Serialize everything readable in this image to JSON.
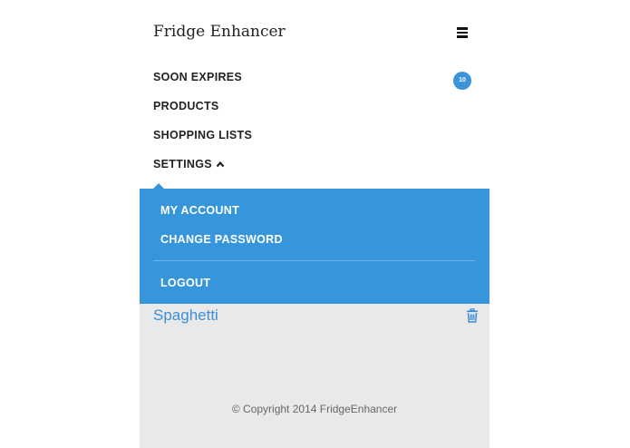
{
  "header": {
    "brand": "Fridge Enhancer",
    "menu_icon": "hamburger-menu-icon"
  },
  "nav": {
    "items": [
      {
        "label": "SOON EXPIRES",
        "badge": "10"
      },
      {
        "label": "PRODUCTS"
      },
      {
        "label": "SHOPPING LISTS"
      },
      {
        "label": "SETTINGS",
        "icon": "chevron-up-icon"
      }
    ]
  },
  "settings_menu": {
    "items": [
      {
        "label": "MY ACCOUNT"
      },
      {
        "label": "CHANGE PASSWORD"
      },
      {
        "label": "LOGOUT"
      }
    ]
  },
  "content": {
    "items": [
      {
        "name": "Spaghetti",
        "icon": "trash-icon"
      }
    ]
  },
  "footer": {
    "copyright": "© Copyright 2014 FridgeEnhancer"
  },
  "colors": {
    "accent": "#3796db",
    "link": "#3a8fd6",
    "content_bg": "#e9e9e9"
  }
}
